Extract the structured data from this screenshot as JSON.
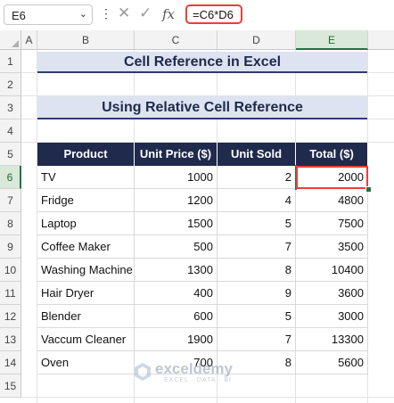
{
  "formula_bar": {
    "name_box": "E6",
    "more_icon": "vertical-ellipsis",
    "cancel_icon": "x-icon",
    "enter_icon": "check-icon",
    "fx_label": "fx",
    "formula": "=C6*D6"
  },
  "columns": [
    "A",
    "B",
    "C",
    "D",
    "E"
  ],
  "rows": [
    "1",
    "2",
    "3",
    "4",
    "5",
    "6",
    "7",
    "8",
    "9",
    "10",
    "11",
    "12",
    "13",
    "14",
    "15"
  ],
  "selected": {
    "column": "E",
    "row": "6"
  },
  "titles": {
    "main": "Cell Reference in Excel",
    "sub": "Using Relative Cell Reference"
  },
  "table": {
    "headers": [
      "Product",
      "Unit Price ($)",
      "Unit Sold",
      "Total ($)"
    ],
    "rows": [
      [
        "TV",
        "1000",
        "2",
        "2000"
      ],
      [
        "Fridge",
        "1200",
        "4",
        "4800"
      ],
      [
        "Laptop",
        "1500",
        "5",
        "7500"
      ],
      [
        "Coffee Maker",
        "500",
        "7",
        "3500"
      ],
      [
        "Washing Machine",
        "1300",
        "8",
        "10400"
      ],
      [
        "Hair Dryer",
        "400",
        "9",
        "3600"
      ],
      [
        "Blender",
        "600",
        "5",
        "3000"
      ],
      [
        "Vaccum Cleaner",
        "1900",
        "7",
        "13300"
      ],
      [
        "Oven",
        "700",
        "8",
        "5600"
      ]
    ]
  },
  "watermark": {
    "name": "exceldemy",
    "tagline": "EXCEL · DATA · BI"
  },
  "colors": {
    "header_bg": "#1f2a4d",
    "title_bg": "#dde3f0",
    "selection": "#e8403a",
    "excel_green": "#217346"
  }
}
